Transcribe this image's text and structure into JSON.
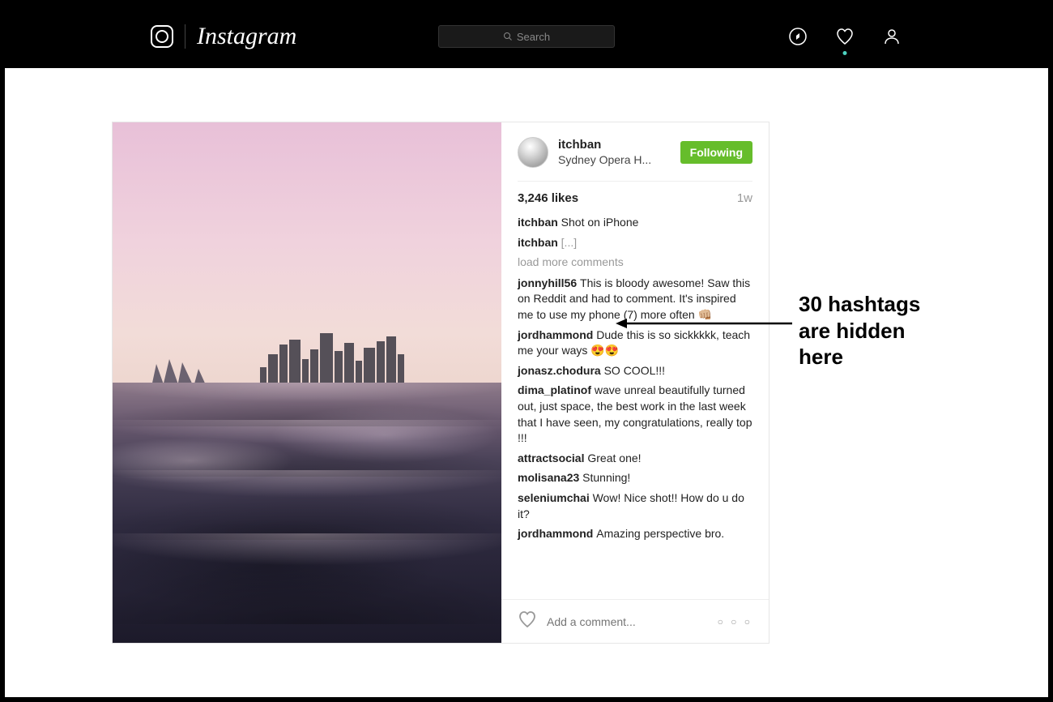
{
  "header": {
    "brand": "Instagram",
    "search_placeholder": "Search"
  },
  "post": {
    "author": "itchban",
    "location": "Sydney Opera H...",
    "follow_label": "Following",
    "likes": "3,246 likes",
    "timestamp": "1w",
    "caption_author": "itchban",
    "caption": "Shot on iPhone",
    "hidden_author": "itchban",
    "hidden_ellipsis": "[...]",
    "load_more": "load more comments",
    "comments": [
      {
        "u": "jonnyhill56",
        "t": "This is bloody awesome! Saw this on Reddit and had to comment. It's inspired me to use my phone (7) more often 👊🏼"
      },
      {
        "u": "jordhammond",
        "t": "Dude this is so sickkkkk, teach me your ways 😍😍"
      },
      {
        "u": "jonasz.chodura",
        "t": "SO COOL!!!"
      },
      {
        "u": "dima_platinof",
        "t": "wave unreal beautifully turned out, just space, the best work in the last week that I have seen, my congratulations, really top !!!"
      },
      {
        "u": "attractsocial",
        "t": "Great one!"
      },
      {
        "u": "molisana23",
        "t": "Stunning!"
      },
      {
        "u": "seleniumchai",
        "t": "Wow! Nice shot!! How do u do it?"
      },
      {
        "u": "jordhammond",
        "t": "Amazing perspective bro."
      }
    ],
    "add_comment_placeholder": "Add a comment..."
  },
  "annotation": {
    "line1": "30 hashtags",
    "line2": "are hidden",
    "line3": "here"
  }
}
